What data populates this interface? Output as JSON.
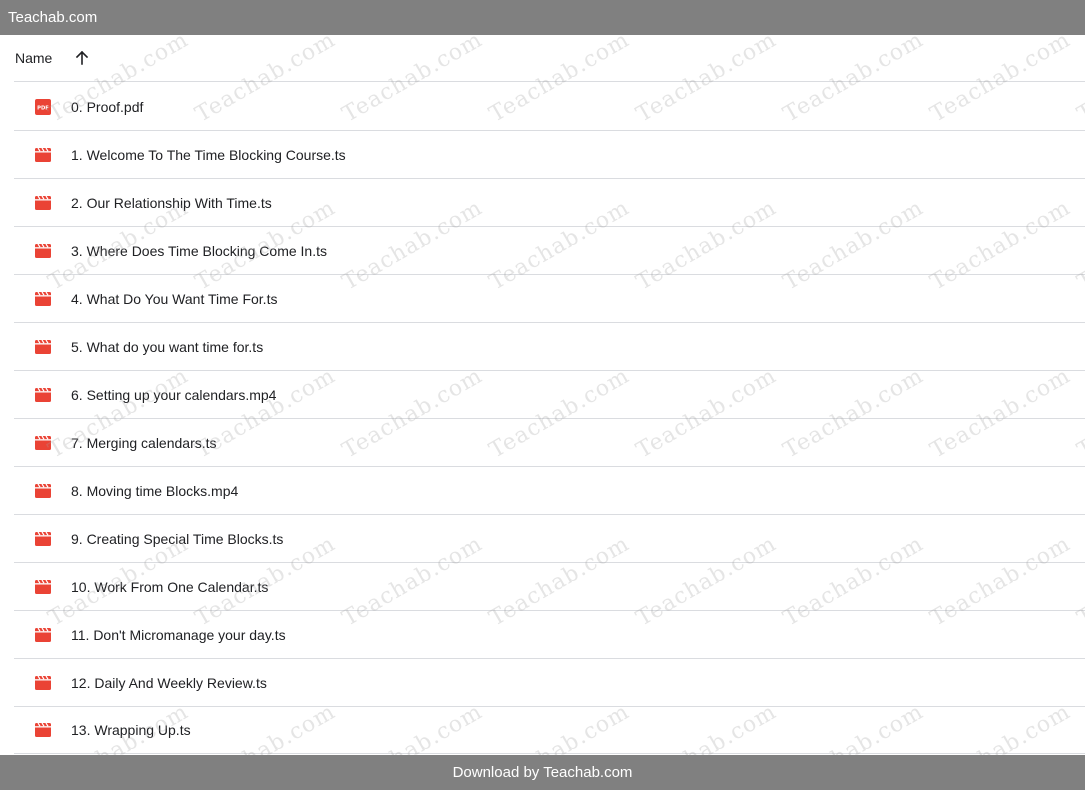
{
  "window": {
    "title": "Teachab.com"
  },
  "list_header": {
    "name_label": "Name",
    "sort_icon": "arrow-up-icon",
    "sort_direction": "ascending"
  },
  "files": [
    {
      "name": "0. Proof.pdf",
      "icon": "pdf-icon"
    },
    {
      "name": "1. Welcome To The Time Blocking Course.ts",
      "icon": "video-icon"
    },
    {
      "name": "2. Our Relationship With Time.ts",
      "icon": "video-icon"
    },
    {
      "name": "3. Where Does Time Blocking Come In.ts",
      "icon": "video-icon"
    },
    {
      "name": "4. What Do You Want Time For.ts",
      "icon": "video-icon"
    },
    {
      "name": "5. What do you want time for.ts",
      "icon": "video-icon"
    },
    {
      "name": "6. Setting up your calendars.mp4",
      "icon": "video-icon"
    },
    {
      "name": "7. Merging calendars.ts",
      "icon": "video-icon"
    },
    {
      "name": "8. Moving time Blocks.mp4",
      "icon": "video-icon"
    },
    {
      "name": "9. Creating Special Time Blocks.ts",
      "icon": "video-icon"
    },
    {
      "name": "10. Work From One Calendar.ts",
      "icon": "video-icon"
    },
    {
      "name": "11. Don't Micromanage your day.ts",
      "icon": "video-icon"
    },
    {
      "name": "12. Daily And Weekly Review.ts",
      "icon": "video-icon"
    },
    {
      "name": "13. Wrapping Up.ts",
      "icon": "video-icon"
    }
  ],
  "footer": {
    "text": "Download by Teachab.com"
  },
  "watermark": {
    "text": "Teachab.com"
  },
  "colors": {
    "bar_bg": "#808080",
    "file_icon_red": "#ea4335",
    "divider": "#dadce0"
  }
}
